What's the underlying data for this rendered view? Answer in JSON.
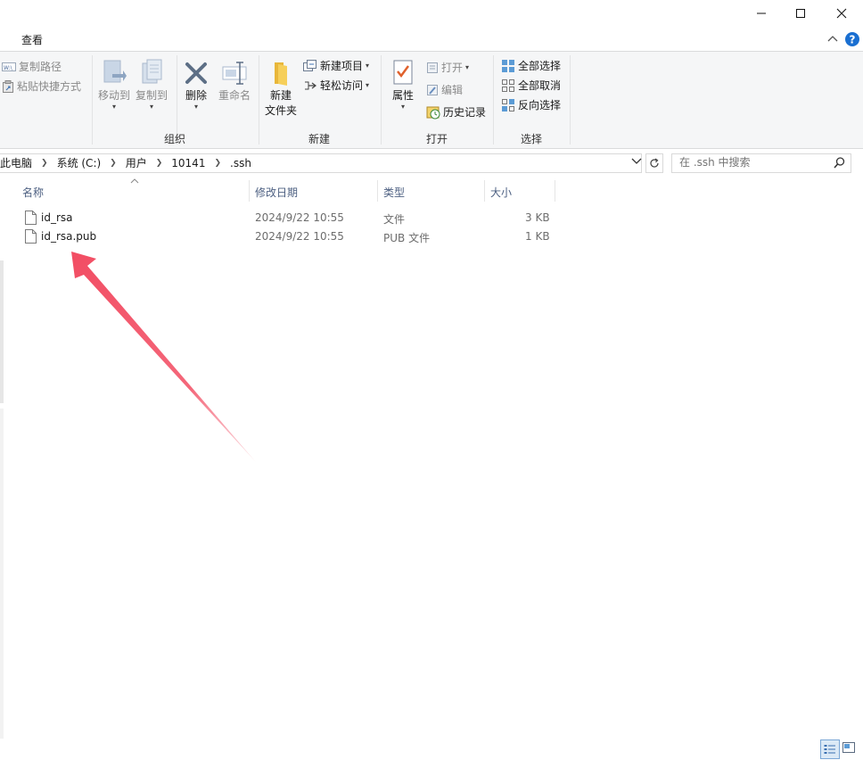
{
  "window": {
    "minimize_icon": "minimize-icon",
    "maximize_icon": "maximize-icon",
    "close_icon": "close-icon"
  },
  "tabs": {
    "view": "查看"
  },
  "ribbon": {
    "organize": {
      "copy_path": "复制路径",
      "paste_shortcut": "粘贴快捷方式",
      "move_to": "移动到",
      "copy_to": "复制到",
      "delete": "删除",
      "rename": "重命名",
      "label": "组织"
    },
    "new": {
      "new_folder_line1": "新建",
      "new_folder_line2": "文件夹",
      "new_item": "新建项目",
      "easy_access": "轻松访问",
      "label": "新建"
    },
    "open": {
      "properties": "属性",
      "open": "打开",
      "edit": "编辑",
      "history": "历史记录",
      "label": "打开"
    },
    "select": {
      "select_all": "全部选择",
      "select_none": "全部取消",
      "invert": "反向选择",
      "label": "选择"
    }
  },
  "address": {
    "crumbs": [
      "此电脑",
      "系统 (C:)",
      "用户",
      "10141",
      ".ssh"
    ]
  },
  "search": {
    "placeholder": "在 .ssh 中搜索"
  },
  "columns": {
    "name": "名称",
    "modified": "修改日期",
    "type": "类型",
    "size": "大小"
  },
  "files": [
    {
      "name": "id_rsa",
      "modified": "2024/9/22 10:55",
      "type": "文件",
      "size": "3 KB"
    },
    {
      "name": "id_rsa.pub",
      "modified": "2024/9/22 10:55",
      "type": "PUB 文件",
      "size": "1 KB"
    }
  ],
  "colors": {
    "accent": "#0a64c8",
    "arrow": "#f24d63",
    "header_text": "#4d6082"
  }
}
